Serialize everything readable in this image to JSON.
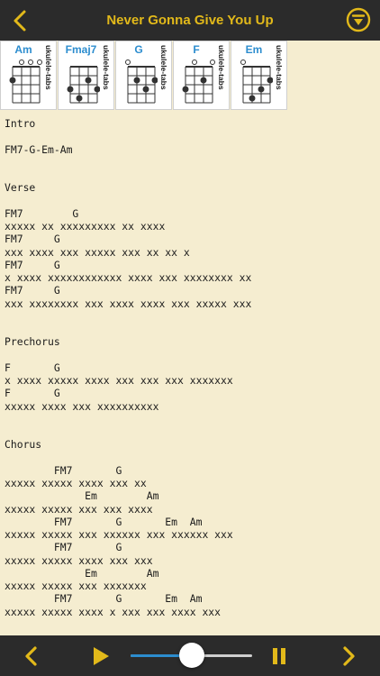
{
  "header": {
    "title": "Never Gonna Give You Up",
    "back_icon": "chevron-left-icon",
    "filter_icon": "filter-circle-icon"
  },
  "chords": [
    {
      "name": "Am",
      "brand": "ukulele-tabs"
    },
    {
      "name": "Fmaj7",
      "brand": "ukulele-tabs"
    },
    {
      "name": "G",
      "brand": "ukulele-tabs"
    },
    {
      "name": "F",
      "brand": "ukulele-tabs"
    },
    {
      "name": "Em",
      "brand": "ukulele-tabs"
    }
  ],
  "sheet_lines": [
    "Intro",
    "",
    "FM7-G-Em-Am",
    "",
    "",
    "Verse",
    "",
    "FM7        G",
    "xxxxx xx xxxxxxxxx xx xxxx",
    "FM7     G",
    "xxx xxxx xxx xxxxx xxx xx xx x",
    "FM7     G",
    "x xxxx xxxxxxxxxxxx xxxx xxx xxxxxxxx xx",
    "FM7     G",
    "xxx xxxxxxxx xxx xxxx xxxx xxx xxxxx xxx",
    "",
    "",
    "Prechorus",
    "",
    "F       G",
    "x xxxx xxxxx xxxx xxx xxx xxx xxxxxxx",
    "F       G",
    "xxxxx xxxx xxx xxxxxxxxxx",
    "",
    "",
    "Chorus",
    "",
    "        FM7       G",
    "xxxxx xxxxx xxxx xxx xx",
    "             Em        Am",
    "xxxxx xxxxx xxx xxx xxxx",
    "        FM7       G       Em  Am",
    "xxxxx xxxxx xxx xxxxxx xxx xxxxxx xxx",
    "        FM7       G",
    "xxxxx xxxxx xxxx xxx xxx",
    "             Em        Am",
    "xxxxx xxxxx xxx xxxxxxx",
    "        FM7       G       Em  Am",
    "xxxxx xxxxx xxxx x xxx xxx xxxx xxx"
  ],
  "player": {
    "prev_icon": "chevron-left-icon",
    "play_icon": "play-icon",
    "pause_icon": "pause-icon",
    "next_icon": "chevron-right-icon",
    "speed_level": 0.5,
    "accent": "#e2b91a",
    "slider_color": "#2c8dcf"
  }
}
